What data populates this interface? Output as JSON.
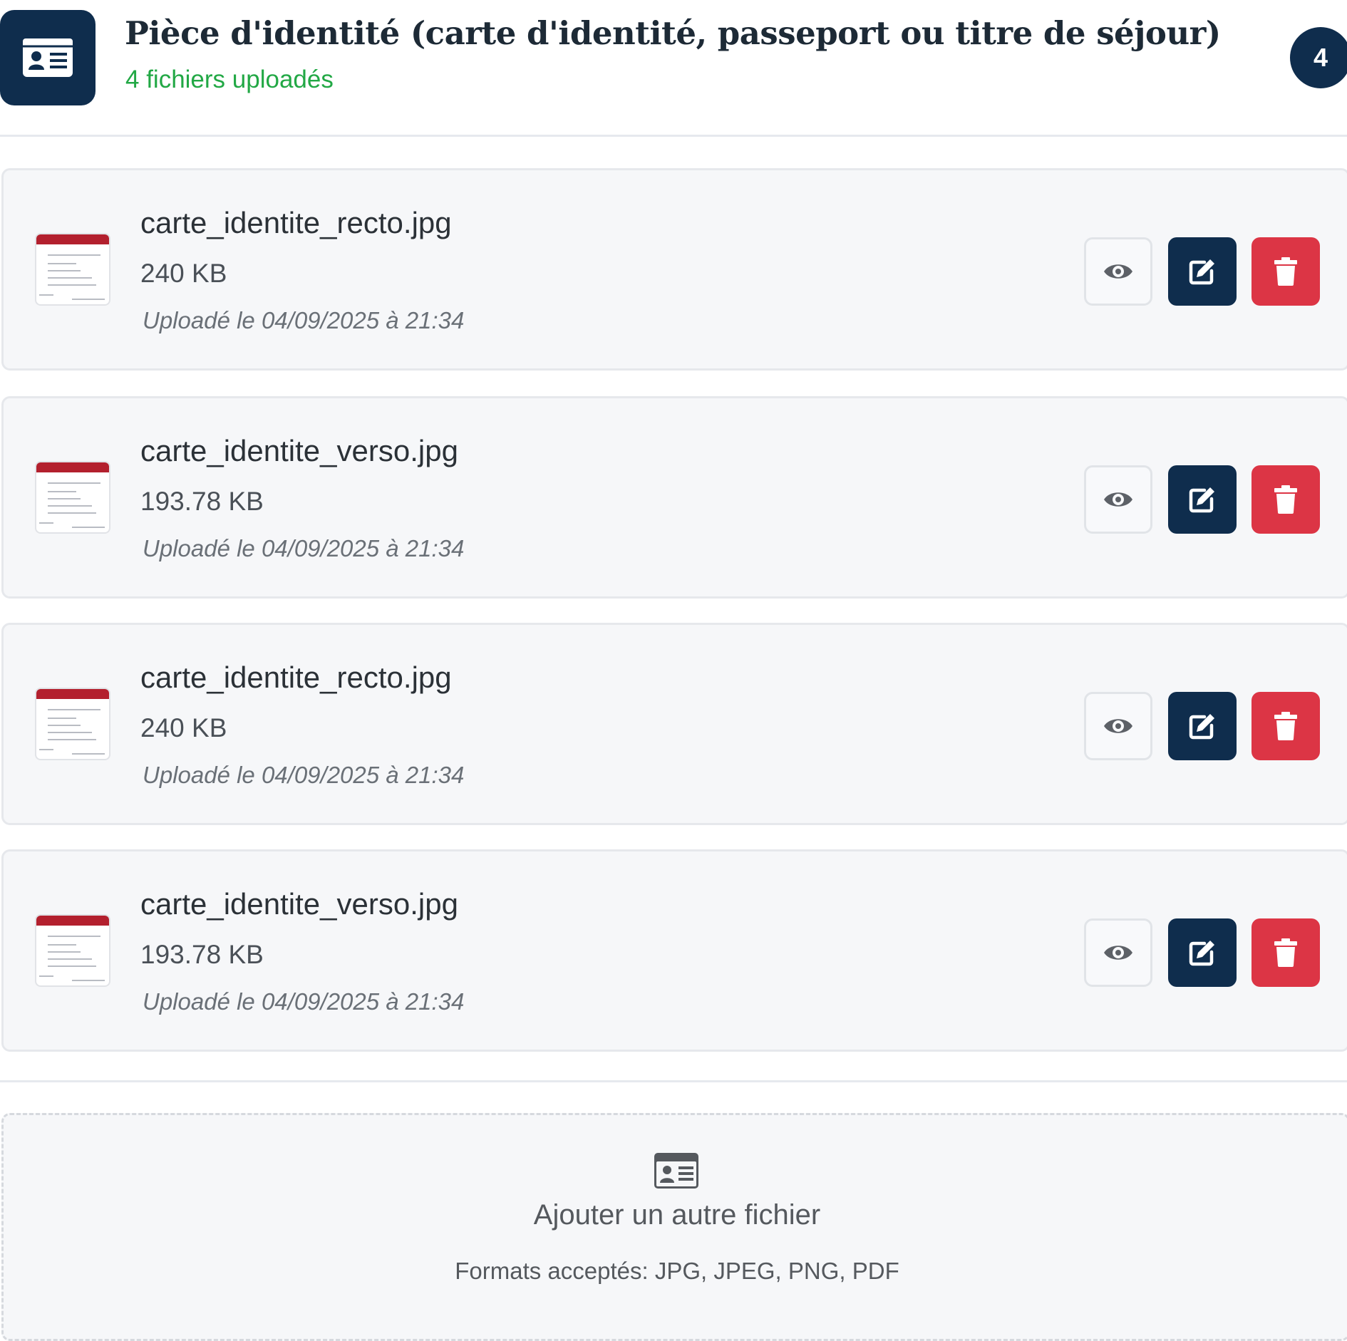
{
  "header": {
    "title": "Pièce d'identité (carte d'identité, passeport ou titre de séjour)",
    "subtitle": "4 fichiers uploadés",
    "count": "4",
    "icon": "id-card-icon",
    "accent_color": "#0f2d4d",
    "success_color": "#22a845"
  },
  "files": [
    {
      "name": "carte_identite_recto.jpg",
      "size": "240 KB",
      "uploaded": "Uploadé le 04/09/2025 à 21:34"
    },
    {
      "name": "carte_identite_verso.jpg",
      "size": "193.78 KB",
      "uploaded": "Uploadé le 04/09/2025 à 21:34"
    },
    {
      "name": "carte_identite_recto.jpg",
      "size": "240 KB",
      "uploaded": "Uploadé le 04/09/2025 à 21:34"
    },
    {
      "name": "carte_identite_verso.jpg",
      "size": "193.78 KB",
      "uploaded": "Uploadé le 04/09/2025 à 21:34"
    }
  ],
  "actions": {
    "view_icon": "eye-icon",
    "edit_icon": "edit-icon",
    "delete_icon": "trash-icon",
    "edit_color": "#0f2d4d",
    "delete_color": "#dc3545"
  },
  "add_zone": {
    "icon": "id-card-icon",
    "label": "Ajouter un autre fichier",
    "formats": "Formats acceptés: JPG, JPEG, PNG, PDF"
  }
}
